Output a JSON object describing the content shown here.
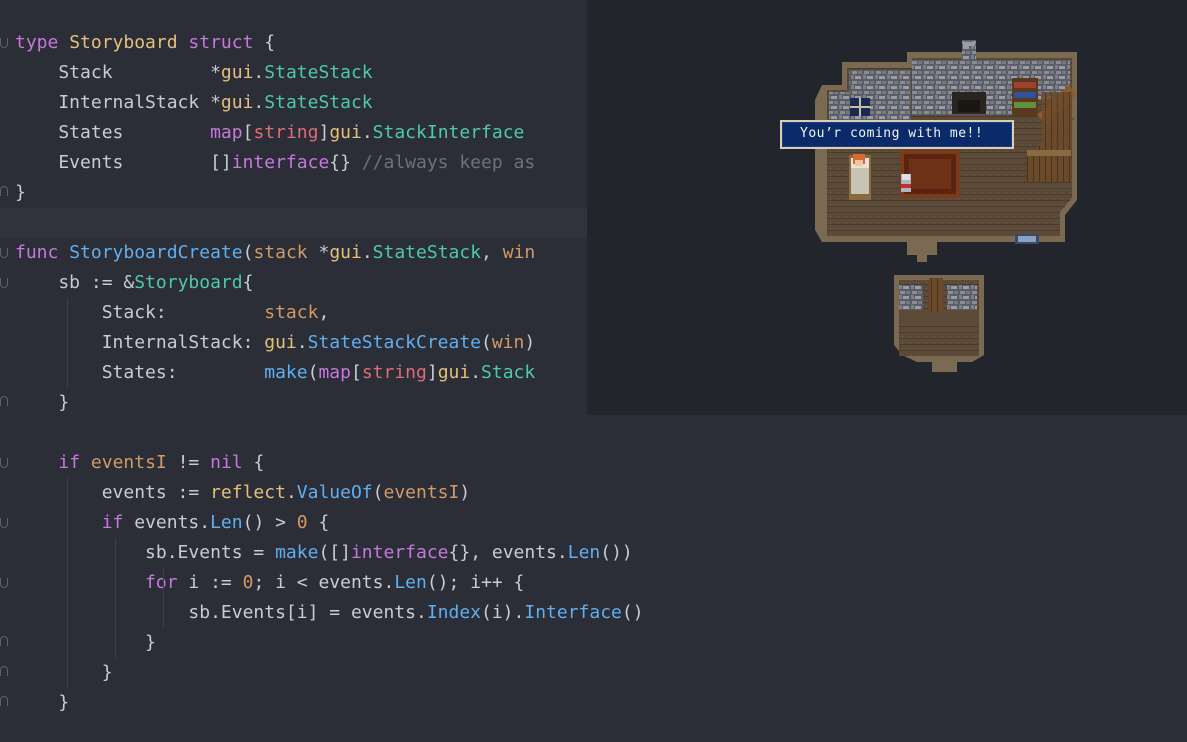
{
  "window": {
    "title": ""
  },
  "code_lines": [
    {
      "tokens": [
        [
          "k",
          "type"
        ],
        [
          "s",
          " "
        ],
        [
          "t",
          "Storyboard"
        ],
        [
          "s",
          " "
        ],
        [
          "k",
          "struct"
        ],
        [
          "s",
          " {"
        ]
      ]
    },
    {
      "tokens": [
        [
          "s",
          "    Stack         *"
        ],
        [
          "pk",
          "gui"
        ],
        [
          "s",
          "."
        ],
        [
          "ty",
          "StateStack"
        ]
      ]
    },
    {
      "tokens": [
        [
          "s",
          "    InternalStack *"
        ],
        [
          "pk",
          "gui"
        ],
        [
          "s",
          "."
        ],
        [
          "ty",
          "StateStack"
        ]
      ]
    },
    {
      "tokens": [
        [
          "s",
          "    States        "
        ],
        [
          "k",
          "map"
        ],
        [
          "s",
          "["
        ],
        [
          "r",
          "string"
        ],
        [
          "s",
          "]"
        ],
        [
          "pk",
          "gui"
        ],
        [
          "s",
          "."
        ],
        [
          "ty",
          "StackInterface"
        ]
      ]
    },
    {
      "tokens": [
        [
          "s",
          "    Events        []"
        ],
        [
          "k",
          "interface"
        ],
        [
          "s",
          "{} "
        ],
        [
          "c",
          "//always keep as"
        ]
      ]
    },
    {
      "tokens": [
        [
          "s",
          "}"
        ]
      ]
    },
    {
      "tokens": []
    },
    {
      "tokens": [
        [
          "k",
          "func"
        ],
        [
          "s",
          " "
        ],
        [
          "f",
          "StoryboardCreate"
        ],
        [
          "s",
          "("
        ],
        [
          "p",
          "stack"
        ],
        [
          "s",
          " *"
        ],
        [
          "pk",
          "gui"
        ],
        [
          "s",
          "."
        ],
        [
          "ty",
          "StateStack"
        ],
        [
          "s",
          ", "
        ],
        [
          "p",
          "win"
        ]
      ]
    },
    {
      "tokens": [
        [
          "s",
          "    sb := &"
        ],
        [
          "ty",
          "Storyboard"
        ],
        [
          "s",
          "{"
        ]
      ]
    },
    {
      "tokens": [
        [
          "s",
          "        Stack:         "
        ],
        [
          "p",
          "stack"
        ],
        [
          "s",
          ","
        ]
      ]
    },
    {
      "tokens": [
        [
          "s",
          "        InternalStack: "
        ],
        [
          "pk",
          "gui"
        ],
        [
          "s",
          "."
        ],
        [
          "f",
          "StateStackCreate"
        ],
        [
          "s",
          "("
        ],
        [
          "p",
          "win"
        ],
        [
          "s",
          ")"
        ]
      ]
    },
    {
      "tokens": [
        [
          "s",
          "        States:        "
        ],
        [
          "f",
          "make"
        ],
        [
          "s",
          "("
        ],
        [
          "k",
          "map"
        ],
        [
          "s",
          "["
        ],
        [
          "r",
          "string"
        ],
        [
          "s",
          "]"
        ],
        [
          "pk",
          "gui"
        ],
        [
          "s",
          "."
        ],
        [
          "ty",
          "Stack"
        ]
      ]
    },
    {
      "tokens": [
        [
          "s",
          "    }"
        ]
      ]
    },
    {
      "tokens": []
    },
    {
      "tokens": [
        [
          "s",
          "    "
        ],
        [
          "k",
          "if"
        ],
        [
          "s",
          " "
        ],
        [
          "p",
          "eventsI"
        ],
        [
          "s",
          " != "
        ],
        [
          "k",
          "nil"
        ],
        [
          "s",
          " {"
        ]
      ]
    },
    {
      "tokens": [
        [
          "s",
          "        events := "
        ],
        [
          "pk",
          "reflect"
        ],
        [
          "s",
          "."
        ],
        [
          "f",
          "ValueOf"
        ],
        [
          "s",
          "("
        ],
        [
          "p",
          "eventsI"
        ],
        [
          "s",
          ")"
        ]
      ]
    },
    {
      "tokens": [
        [
          "s",
          "        "
        ],
        [
          "k",
          "if"
        ],
        [
          "s",
          " events."
        ],
        [
          "f",
          "Len"
        ],
        [
          "s",
          "() > "
        ],
        [
          "n",
          "0"
        ],
        [
          "s",
          " {"
        ]
      ]
    },
    {
      "tokens": [
        [
          "s",
          "            sb.Events = "
        ],
        [
          "f",
          "make"
        ],
        [
          "s",
          "([]"
        ],
        [
          "k",
          "interface"
        ],
        [
          "s",
          "{}, events."
        ],
        [
          "f",
          "Len"
        ],
        [
          "s",
          "())"
        ]
      ]
    },
    {
      "tokens": [
        [
          "s",
          "            "
        ],
        [
          "k",
          "for"
        ],
        [
          "s",
          " i := "
        ],
        [
          "n",
          "0"
        ],
        [
          "s",
          "; i < events."
        ],
        [
          "f",
          "Len"
        ],
        [
          "s",
          "(); i++ {"
        ]
      ]
    },
    {
      "tokens": [
        [
          "s",
          "                sb.Events[i] = events."
        ],
        [
          "f",
          "Index"
        ],
        [
          "s",
          "(i)."
        ],
        [
          "f",
          "Interface"
        ],
        [
          "s",
          "()"
        ]
      ]
    },
    {
      "tokens": [
        [
          "s",
          "            }"
        ]
      ]
    },
    {
      "tokens": [
        [
          "s",
          "        }"
        ]
      ]
    },
    {
      "tokens": [
        [
          "s",
          "    }"
        ]
      ]
    }
  ],
  "game": {
    "dialog_text": "You’r coming with me!!"
  }
}
